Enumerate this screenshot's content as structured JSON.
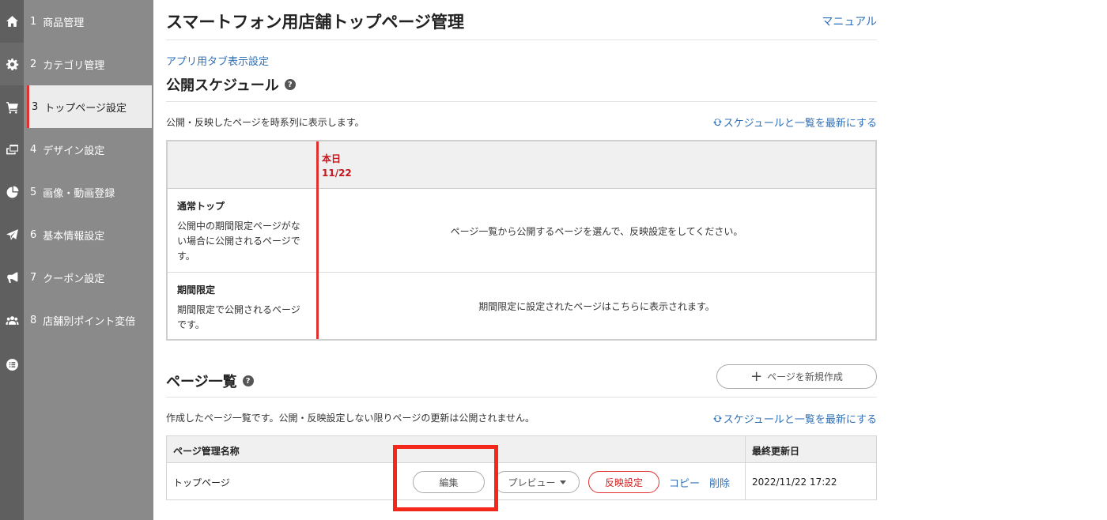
{
  "sidebar": {
    "items": [
      {
        "num": "1",
        "label": "商品管理",
        "icon": "home-icon"
      },
      {
        "num": "2",
        "label": "カテゴリ管理",
        "icon": "gear-icon"
      },
      {
        "num": "3",
        "label": "トップページ設定",
        "icon": "cart-icon",
        "active": true
      },
      {
        "num": "4",
        "label": "デザイン設定",
        "icon": "windows-icon"
      },
      {
        "num": "5",
        "label": "画像・動画登録",
        "icon": "pie-chart-icon"
      },
      {
        "num": "6",
        "label": "基本情報設定",
        "icon": "paper-plane-icon"
      },
      {
        "num": "7",
        "label": "クーポン設定",
        "icon": "bullhorn-icon"
      },
      {
        "num": "8",
        "label": "店舗別ポイント変倍",
        "icon": "users-icon"
      }
    ],
    "extra_icon": "list-icon"
  },
  "header": {
    "title": "スマートフォン用店舗トップページ管理",
    "manual_link": "マニュアル"
  },
  "app_tab_link": "アプリ用タブ表示設定",
  "schedule": {
    "title": "公開スケジュール",
    "description": "公開・反映したページを時系列に表示します。",
    "refresh_link": "スケジュールと一覧を最新にする",
    "today_label": "本日",
    "today_date": "11/22",
    "rows": [
      {
        "title": "通常トップ",
        "description": "公開中の期間限定ページがない場合に公開されるページです。",
        "message": "ページ一覧から公開するページを選んで、反映設定をしてください。"
      },
      {
        "title": "期間限定",
        "description": "期間限定で公開されるページです。",
        "message": "期間限定に設定されたページはこちらに表示されます。"
      }
    ]
  },
  "page_list": {
    "title": "ページ一覧",
    "new_button": "ページを新規作成",
    "description": "作成したページ一覧です。公開・反映設定しない限りページの更新は公開されません。",
    "refresh_link": "スケジュールと一覧を最新にする",
    "columns": {
      "name": "ページ管理名称",
      "updated": "最終更新日"
    },
    "rows": [
      {
        "name": "トップページ",
        "edit": "編集",
        "preview": "プレビュー",
        "reflect": "反映設定",
        "copy": "コピー",
        "delete": "削除",
        "updated": "2022/11/22 17:22"
      }
    ]
  },
  "colors": {
    "accent_red": "#e0312f",
    "link_blue": "#2f6fb7",
    "highlight_red": "#f4281a"
  }
}
